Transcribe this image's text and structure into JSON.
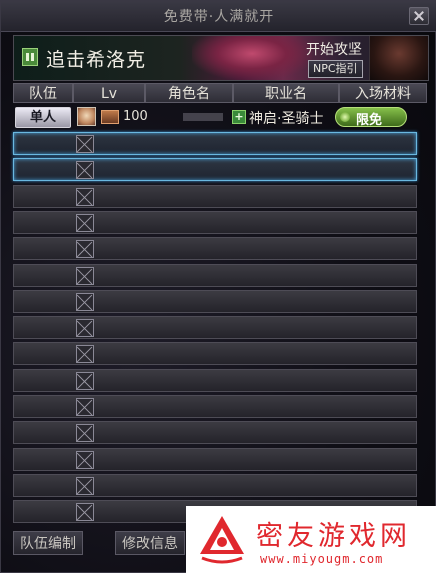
{
  "window": {
    "title": "免费带·人满就开"
  },
  "banner": {
    "dungeon_name": "追击希洛克",
    "start_strategy": "开始攻坚",
    "npc_guide": "NPC指引"
  },
  "table": {
    "headers": [
      "队伍",
      "Lv",
      "角色名",
      "职业名",
      "入场材料"
    ]
  },
  "member": {
    "team_badge": "单人",
    "level": "100",
    "class_name": "神启·圣骑士",
    "ticket": "限免"
  },
  "empty_slot_count": 15,
  "bottom_buttons": {
    "team_edit": "队伍编制",
    "edit_info": "修改信息"
  },
  "watermark": {
    "name": "密友游戏网",
    "url": "www.miyougm.com"
  },
  "colors": {
    "highlight_border": "#6ab8e0",
    "ticket_green": "#86c04a",
    "watermark_red": "#e0282e"
  }
}
